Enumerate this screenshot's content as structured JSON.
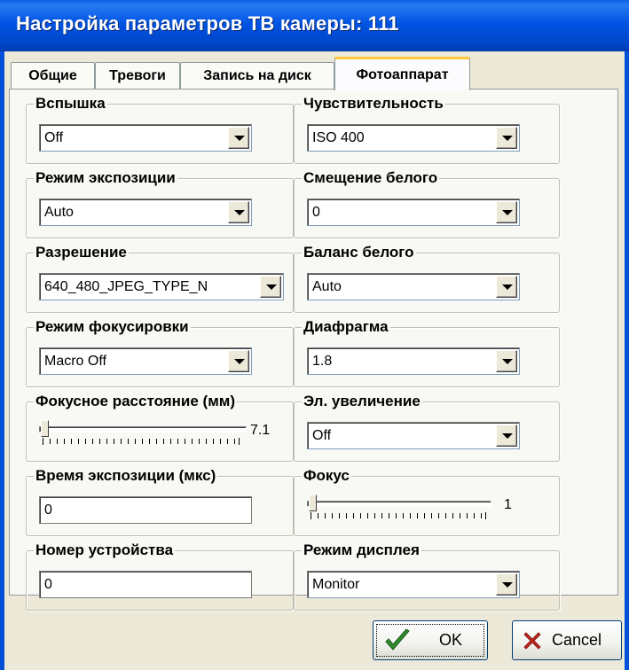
{
  "window": {
    "title": "Настройка параметров ТВ камеры: 111"
  },
  "tabs": [
    {
      "label": "Общие"
    },
    {
      "label": "Тревоги"
    },
    {
      "label": "Запись на диск"
    },
    {
      "label": "Фотоаппарат",
      "active": true
    }
  ],
  "left": {
    "flash": {
      "title": "Вспышка",
      "value": "Off"
    },
    "exposure_mode": {
      "title": "Режим экспозиции",
      "value": "Auto"
    },
    "resolution": {
      "title": "Разрешение",
      "value": "640_480_JPEG_TYPE_N"
    },
    "focus_mode": {
      "title": "Режим фокусировки",
      "value": "Macro Off"
    },
    "focal_length": {
      "title": "Фокусное расстояние (мм)",
      "value": "7.1"
    },
    "exposure_time": {
      "title": "Время экспозиции (мкс)",
      "value": "0"
    },
    "device_number": {
      "title": "Номер устройства",
      "value": "0"
    }
  },
  "right": {
    "sensitivity": {
      "title": "Чувствительность",
      "value": "ISO 400"
    },
    "white_offset": {
      "title": "Смещение белого",
      "value": "0"
    },
    "white_balance": {
      "title": "Баланс белого",
      "value": "Auto"
    },
    "aperture": {
      "title": "Диафрагма",
      "value": "1.8"
    },
    "digital_zoom": {
      "title": "Эл. увеличение",
      "value": "Off"
    },
    "focus": {
      "title": "Фокус",
      "value": "1"
    },
    "display_mode": {
      "title": "Режим дисплея",
      "value": "Monitor"
    }
  },
  "buttons": {
    "ok": "OK",
    "cancel": "Cancel"
  },
  "colors": {
    "titlebar": "#0054e3",
    "ok_check": "#2e8b2e",
    "cancel_x": "#c0241c"
  },
  "icons": {
    "ok": "check-icon",
    "cancel": "x-icon"
  }
}
